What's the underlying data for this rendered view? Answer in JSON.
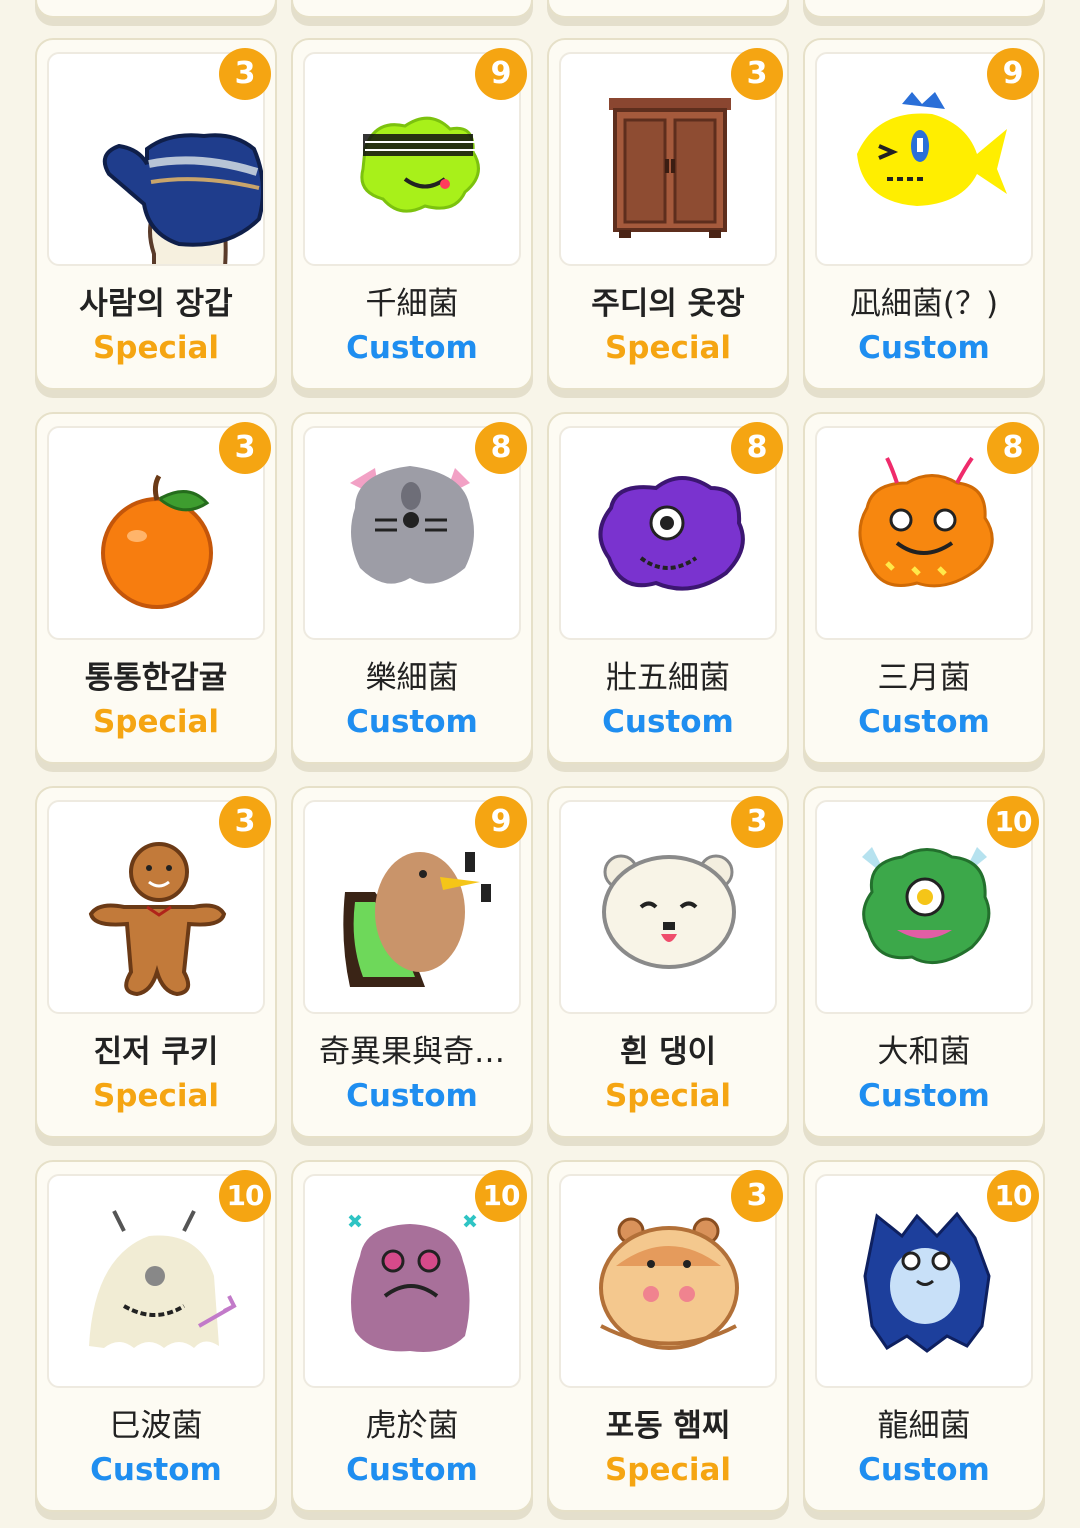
{
  "colors": {
    "background": "#f8f5e9",
    "badge": "#f5a512",
    "special": "#f5a512",
    "custom": "#1f8ef0"
  },
  "cards": [
    {
      "name": "사람의 장갑",
      "type": "Special",
      "count": "3",
      "icon": "blue-mitten-icon"
    },
    {
      "name": "千細菌",
      "type": "Custom",
      "count": "9",
      "icon": "green-germ-icon"
    },
    {
      "name": "주디의 옷장",
      "type": "Special",
      "count": "3",
      "icon": "wardrobe-icon"
    },
    {
      "name": "凪細菌(？)",
      "type": "Custom",
      "count": "9",
      "icon": "yellow-fish-icon"
    },
    {
      "name": "통통한감귤",
      "type": "Special",
      "count": "3",
      "icon": "tangerine-icon"
    },
    {
      "name": "樂細菌",
      "type": "Custom",
      "count": "8",
      "icon": "gray-cat-germ-icon"
    },
    {
      "name": "壯五細菌",
      "type": "Custom",
      "count": "8",
      "icon": "purple-germ-icon"
    },
    {
      "name": "三月菌",
      "type": "Custom",
      "count": "8",
      "icon": "orange-germ-icon"
    },
    {
      "name": "진저 쿠키",
      "type": "Special",
      "count": "3",
      "icon": "gingerbread-icon"
    },
    {
      "name": "奇異果與奇…",
      "type": "Custom",
      "count": "9",
      "icon": "kiwi-bird-icon"
    },
    {
      "name": "흰 댕이",
      "type": "Special",
      "count": "3",
      "icon": "white-dog-icon"
    },
    {
      "name": "大和菌",
      "type": "Custom",
      "count": "10",
      "icon": "green-cyclops-germ-icon"
    },
    {
      "name": "巳波菌",
      "type": "Custom",
      "count": "10",
      "icon": "cream-ghost-germ-icon"
    },
    {
      "name": "虎於菌",
      "type": "Custom",
      "count": "10",
      "icon": "pink-germ-icon"
    },
    {
      "name": "포동 햄찌",
      "type": "Special",
      "count": "3",
      "icon": "hamster-icon"
    },
    {
      "name": "龍細菌",
      "type": "Custom",
      "count": "10",
      "icon": "blue-furry-germ-icon"
    }
  ]
}
